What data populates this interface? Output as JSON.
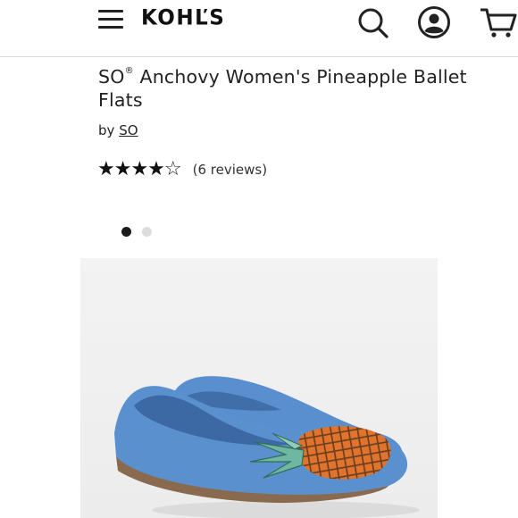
{
  "header": {
    "logo": "KOHĽS",
    "menu_icon": "hamburger-menu-icon",
    "search_icon": "search-icon",
    "account_icon": "account-icon",
    "cart_icon": "cart-icon"
  },
  "product": {
    "title_prefix": "SO",
    "title_mark": "®",
    "title_rest": " Anchovy Women's Pineapple Ballet Flats",
    "by_label": "by",
    "brand": "SO",
    "stars": "★★★★☆",
    "rating": 4,
    "rating_max": 5,
    "reviews": "(6 reviews)"
  },
  "carousel": {
    "count": 2,
    "active_index": 0
  },
  "colors": {
    "shoe_blue": "#5b90cf",
    "pineapple_orange": "#e0742c",
    "leaf_green": "#6fb7a0"
  }
}
